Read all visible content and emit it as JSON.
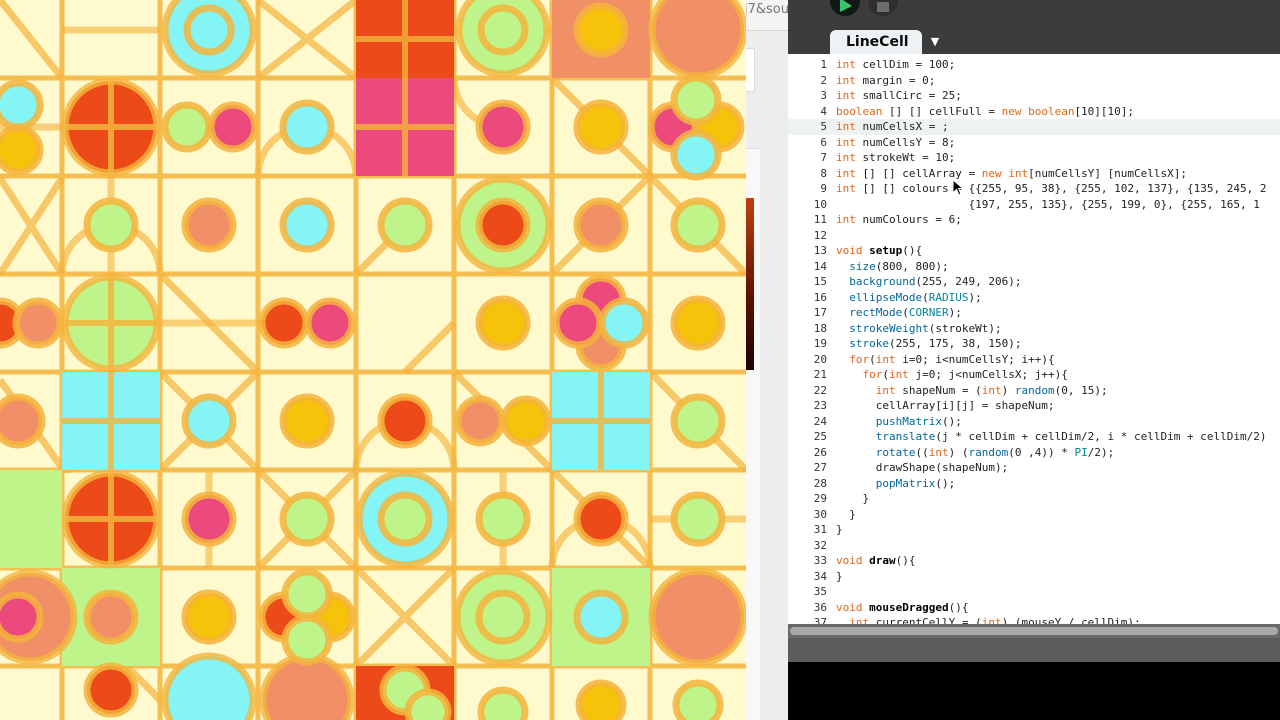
{
  "browser": {
    "url_fragment": "j7&sou"
  },
  "ide": {
    "toolbar": {
      "run_icon": "play-icon",
      "stop_icon": "stop-icon"
    },
    "tab": {
      "label": "LineCell",
      "menu_glyph": "▼"
    },
    "editor": {
      "line_numbers": [
        "1",
        "2",
        "3",
        "4",
        "5",
        "6",
        "7",
        "8",
        "9",
        "10",
        "11",
        "12",
        "13",
        "14",
        "15",
        "16",
        "17",
        "18",
        "19",
        "20",
        "21",
        "22",
        "23",
        "24",
        "25",
        "26",
        "27",
        "28",
        "29",
        "30",
        "31",
        "32",
        "33",
        "34",
        "35",
        "36",
        "37"
      ],
      "lines": [
        "int cellDim = 100;",
        "int margin = 0;",
        "int smallCirc = 25;",
        "boolean [] [] cellFull = new boolean[10][10];",
        "int numCellsX = ;",
        "int numCellsY = 8;",
        "int strokeWt = 10;",
        "int [] [] cellArray = new int[numCellsY] [numCellsX];",
        "int [] [] colours = {{255, 95, 38}, {255, 102, 137}, {135, 245, 2",
        "                    {197, 255, 135}, {255, 199, 0}, {255, 165, 1",
        "int numColours = 6;",
        "",
        "void setup(){",
        "  size(800, 800);",
        "  background(255, 249, 206);",
        "  ellipseMode(RADIUS);",
        "  rectMode(CORNER);",
        "  strokeWeight(strokeWt);",
        "  stroke(255, 175, 38, 150);",
        "  for(int i=0; i<numCellsY; i++){",
        "    for(int j=0; j<numCellsX; j++){",
        "      int shapeNum = (int) random(0, 15);",
        "      cellArray[i][j] = shapeNum;",
        "      pushMatrix();",
        "      translate(j * cellDim + cellDim/2, i * cellDim + cellDim/2)",
        "      rotate((int) (random(0 ,4)) * PI/2);",
        "      drawShape(shapeNum);",
        "      popMatrix();",
        "    }",
        "  }",
        "}",
        "",
        "void draw(){",
        "}",
        "",
        "void mouseDragged(){",
        "  int currentCellY = (int) (mouseY / cellDim);"
      ],
      "current_line": 5
    }
  },
  "colors": {
    "background": "#fff9ce",
    "stroke": "#f5b43c",
    "red": "#ec4a18",
    "pink": "#ec4a7c",
    "cyan": "#84f4f4",
    "green": "#bef48a",
    "yellow": "#f6c20a",
    "salmon": "#f19066",
    "keyword": "#e2661a",
    "function": "#006699",
    "builtin": "#00849a"
  }
}
